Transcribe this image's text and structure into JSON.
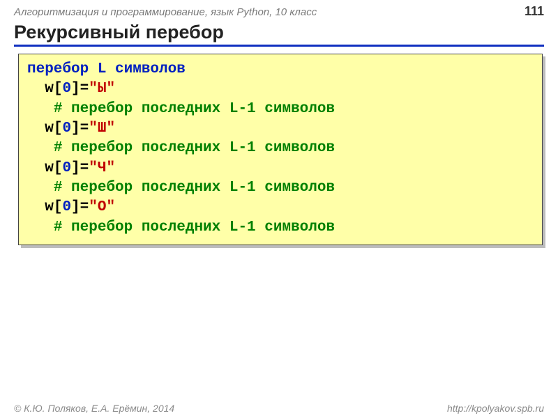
{
  "header": {
    "subject": "Алгоритмизация и программирование, язык Python, 10 класс",
    "page": "111"
  },
  "title": "Рекурсивный перебор",
  "code": {
    "line1_kw": "перебор L символов",
    "arr": "w",
    "lb": "[",
    "idx": "0",
    "rb": "]",
    "eq": "=",
    "s1": "\"Ы\"",
    "s2": "\"Ш\"",
    "s3": "\"Ч\"",
    "s4": "\"О\"",
    "cmt": "# перебор последних L-1 символов"
  },
  "footer": {
    "left": "© К.Ю. Поляков, Е.А. Ерёмин, 2014",
    "right": "http://kpolyakov.spb.ru"
  }
}
